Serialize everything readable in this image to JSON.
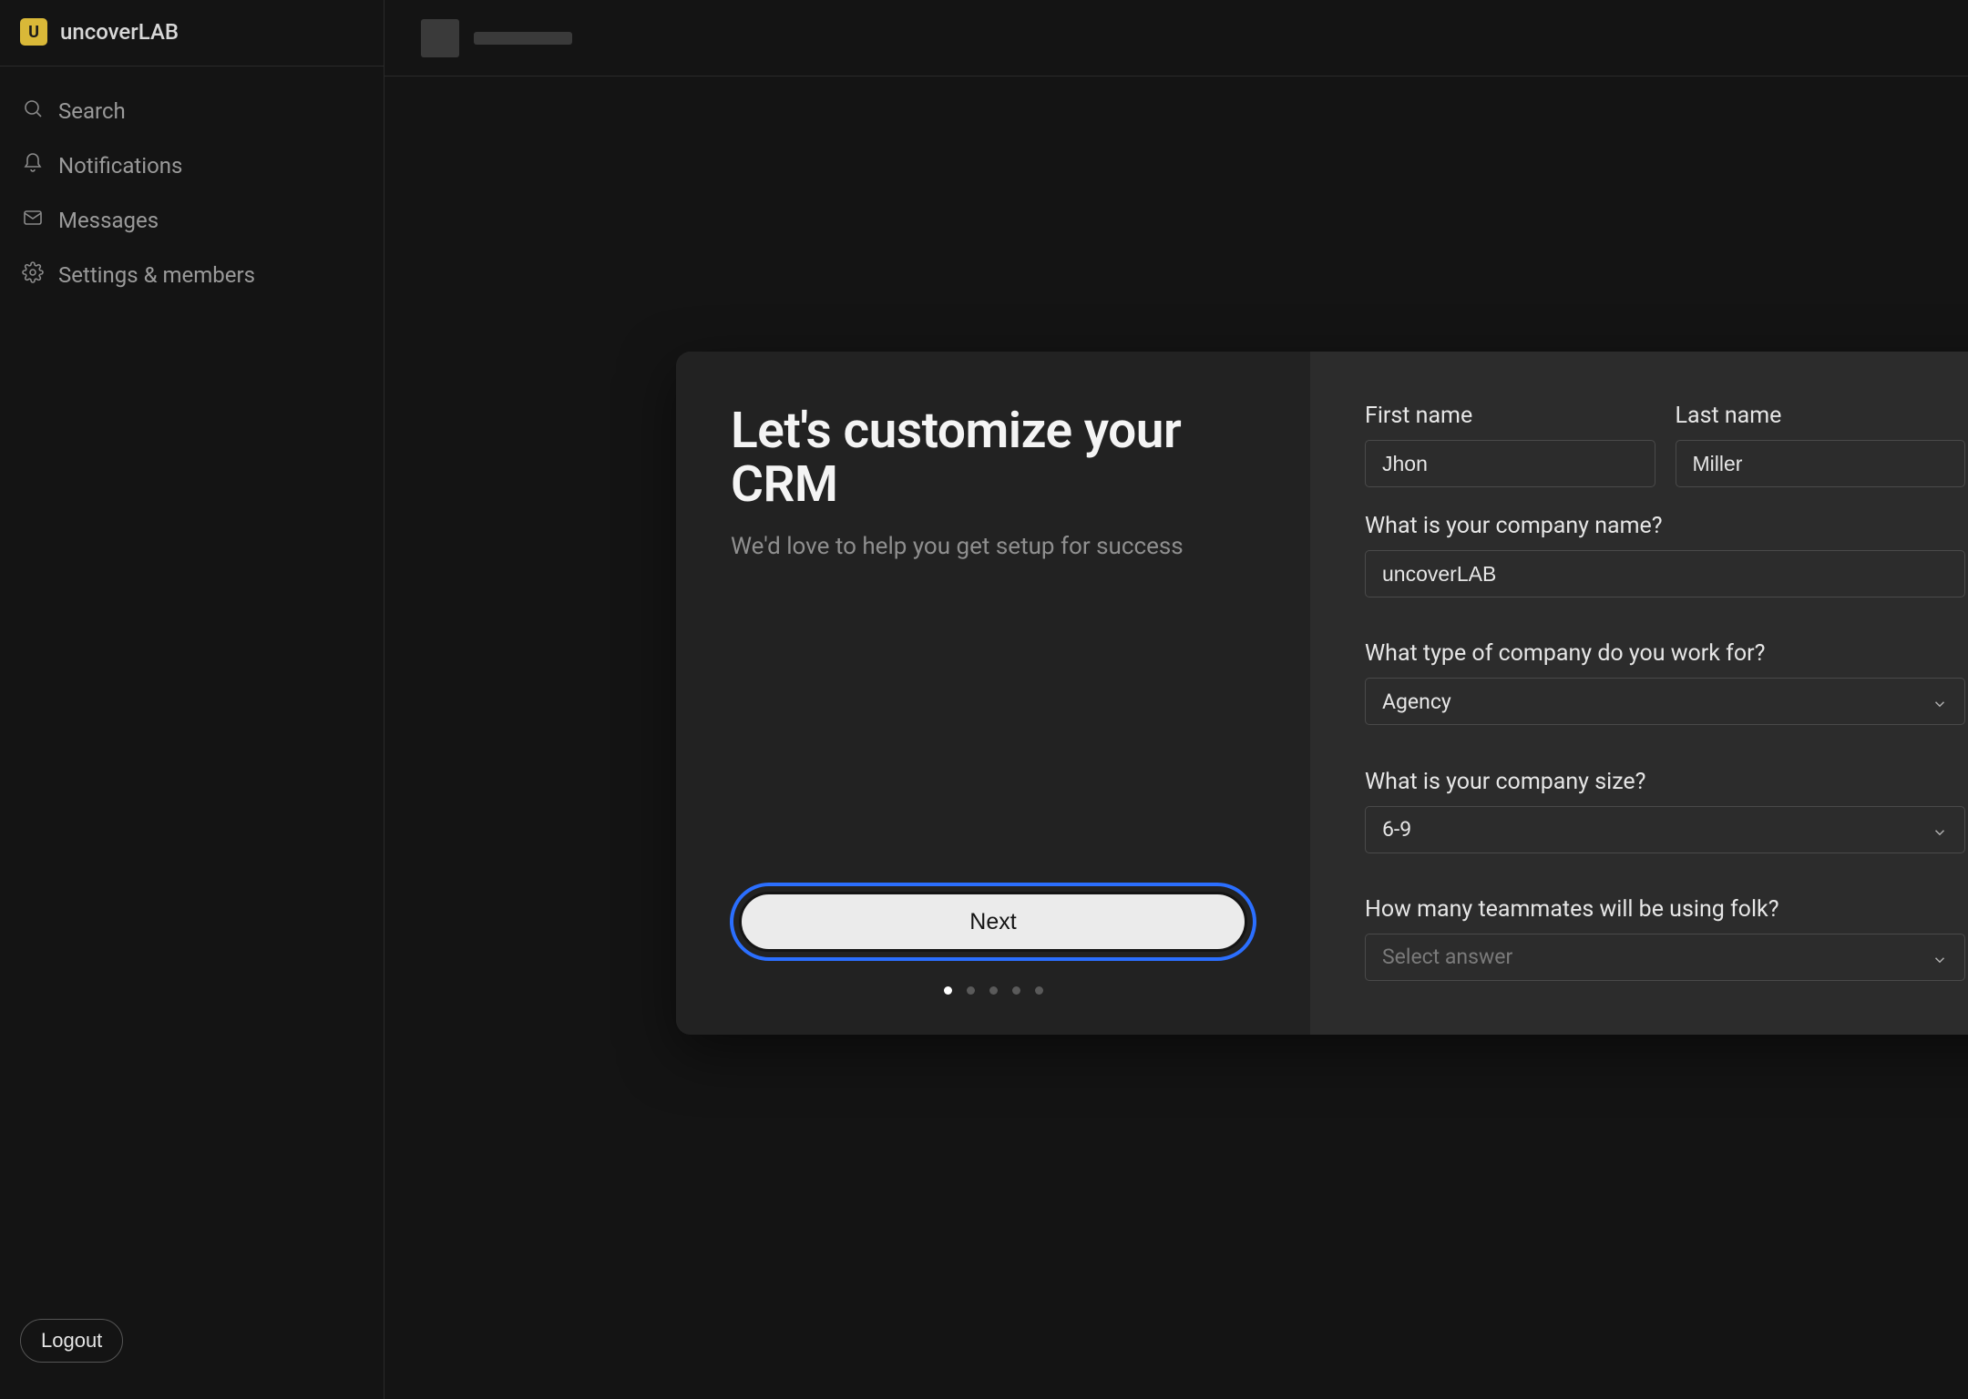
{
  "brand": {
    "logo_letter": "U",
    "name": "uncoverLAB"
  },
  "sidebar": {
    "items": [
      {
        "icon": "search-icon",
        "label": "Search"
      },
      {
        "icon": "bell-icon",
        "label": "Notifications"
      },
      {
        "icon": "mail-icon",
        "label": "Messages"
      },
      {
        "icon": "gear-icon",
        "label": "Settings & members"
      }
    ],
    "logout": "Logout"
  },
  "modal": {
    "title": "Let's customize your CRM",
    "subtitle": "We'd love to help you get setup for success",
    "next_label": "Next",
    "step_count": 5,
    "active_step": 0,
    "form": {
      "first_name": {
        "label": "First name",
        "value": "Jhon"
      },
      "last_name": {
        "label": "Last name",
        "value": "Miller"
      },
      "company_name": {
        "label": "What is your company name?",
        "value": "uncoverLAB"
      },
      "company_type": {
        "label": "What type of company do you work for?",
        "value": "Agency"
      },
      "company_size": {
        "label": "What is your company size?",
        "value": "6-9"
      },
      "teammates": {
        "label": "How many teammates will be using folk?",
        "placeholder": "Select answer"
      }
    }
  }
}
